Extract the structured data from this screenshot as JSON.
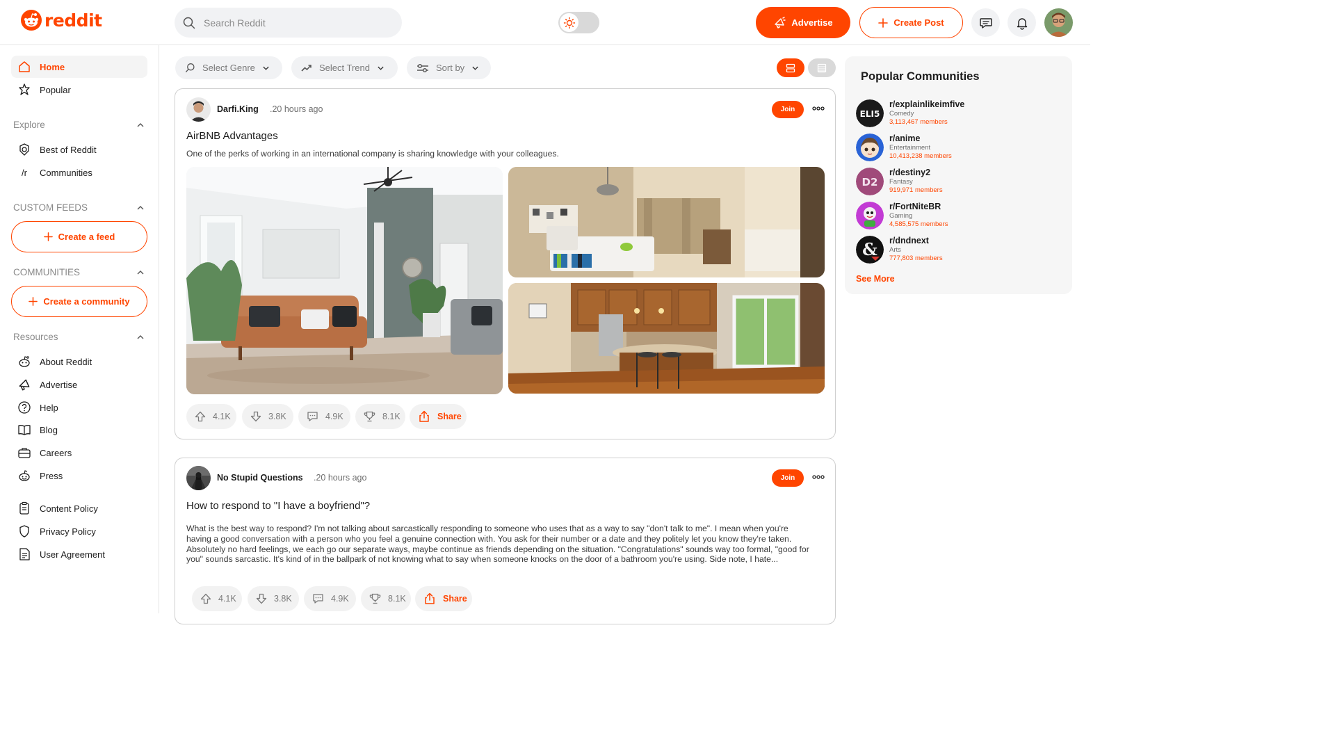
{
  "header": {
    "logo_text": "reddit",
    "search_placeholder": "Search Reddit",
    "advertise_label": "Advertise",
    "create_post_label": "Create Post"
  },
  "sidebar": {
    "nav": [
      {
        "label": "Home",
        "icon": "home-icon",
        "active": true
      },
      {
        "label": "Popular",
        "icon": "popular-icon"
      }
    ],
    "explore": {
      "heading": "Explore",
      "items": [
        {
          "label": "Best of Reddit",
          "icon": "best-of-reddit-icon"
        },
        {
          "label": "Communities",
          "icon": "communities-icon",
          "glyph": "/r"
        }
      ]
    },
    "custom_feeds": {
      "heading": "CUSTOM FEEDS",
      "button": "Create a feed"
    },
    "communities": {
      "heading": "COMMUNITIES",
      "button": "Create a community"
    },
    "resources": {
      "heading": "Resources",
      "items": [
        {
          "label": "About Reddit",
          "icon": "reddit-alien-icon"
        },
        {
          "label": "Advertise",
          "icon": "megaphone-icon"
        },
        {
          "label": "Help",
          "icon": "help-icon"
        },
        {
          "label": "Blog",
          "icon": "book-icon"
        },
        {
          "label": "Careers",
          "icon": "briefcase-icon"
        },
        {
          "label": "Press",
          "icon": "press-icon"
        }
      ]
    },
    "policies": [
      {
        "label": "Content Policy",
        "icon": "clipboard-icon"
      },
      {
        "label": "Privacy Policy",
        "icon": "shield-icon"
      },
      {
        "label": "User Agreement",
        "icon": "document-icon"
      }
    ]
  },
  "filters": {
    "genre": "Select Genre",
    "trend": "Select Trend",
    "sort": "Sort by"
  },
  "posts": [
    {
      "author": "Darfi.King",
      "time": ".20 hours ago",
      "join_label": "Join",
      "title": "AirBNB Advantages",
      "body": "One of the perks of working in an international company is sharing knowledge with your colleagues.",
      "upvotes": "4.1K",
      "downvotes": "3.8K",
      "comments": "4.9K",
      "awards": "8.1K",
      "share_label": "Share"
    },
    {
      "author": "No Stupid Questions",
      "time": ".20 hours ago",
      "join_label": "Join",
      "title": "How to respond to \"I have a boyfriend\"?",
      "body": "What is the best way to respond? I'm not talking about sarcastically responding to someone who uses that as a way to say \"don't talk to me\". I mean when you're having a good conversation with a person who you feel a genuine connection with. You ask for their number or a date and they politely let you know they're taken. Absolutely no hard feelings, we each go our separate ways, maybe continue as friends depending on the situation. \"Congratulations\" sounds way too formal, \"good for you\" sounds sarcastic. It's kind of in the ballpark of not knowing what to say when someone knocks on the door of a bathroom you're using. Side note, I hate...",
      "upvotes": "4.1K",
      "downvotes": "3.8K",
      "comments": "4.9K",
      "awards": "8.1K",
      "share_label": "Share"
    }
  ],
  "popular": {
    "title": "Popular Communities",
    "see_more": "See More",
    "items": [
      {
        "name": "r/explainlikeimfive",
        "category": "Comedy",
        "members": "3,113,467 members",
        "icon_text": "ELI5"
      },
      {
        "name": "r/anime",
        "category": "Entertainment",
        "members": "10,413,238 members"
      },
      {
        "name": "r/destiny2",
        "category": "Fantasy",
        "members": "919,971 members",
        "icon_text": "D2"
      },
      {
        "name": "r/FortNiteBR",
        "category": "Gaming",
        "members": "4,585,575 members"
      },
      {
        "name": "r/dndnext",
        "category": "Arts",
        "members": "777,803 members",
        "icon_text": "&"
      }
    ]
  },
  "colors": {
    "accent": "#ff4500",
    "text": "#1c1c1c",
    "muted": "#8a8a8a",
    "panel": "#f6f6f6"
  }
}
